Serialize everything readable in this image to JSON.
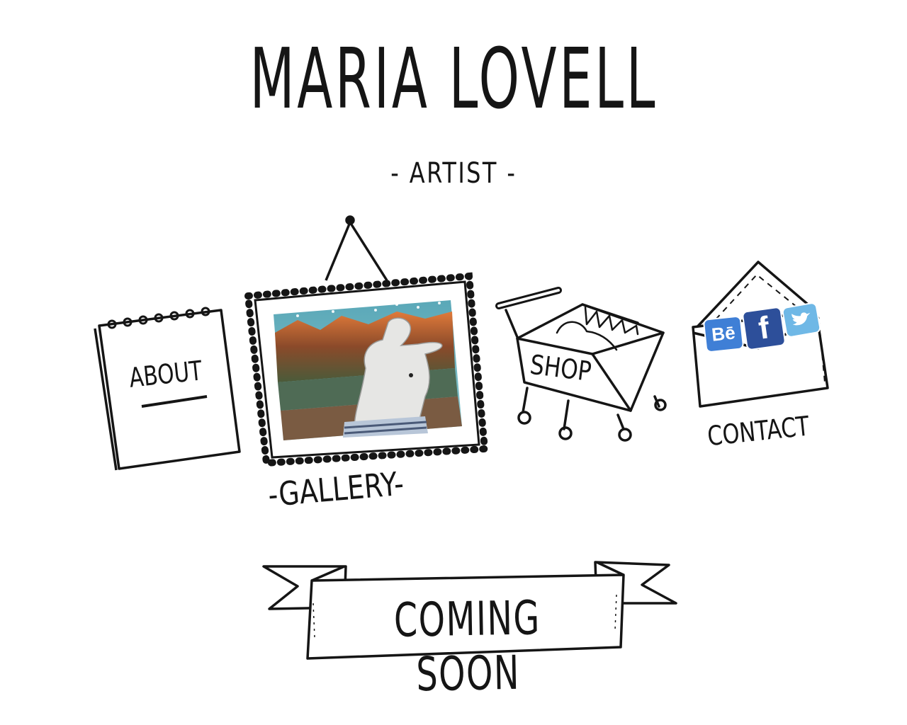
{
  "header": {
    "title": "MARIA LOVELL",
    "subtitle": "- ARTIST -"
  },
  "nav": {
    "about": "ABOUT",
    "gallery": "-GALLERY-",
    "shop": "SHOP",
    "contact": "CONTACT"
  },
  "social": {
    "behance": "Bē",
    "facebook": "f"
  },
  "banner": {
    "text": "COMING SOON"
  },
  "colors": {
    "ink": "#151515",
    "behance": "#3f7fd6",
    "facebook": "#2d4f9a",
    "twitter": "#6fb8e6"
  }
}
